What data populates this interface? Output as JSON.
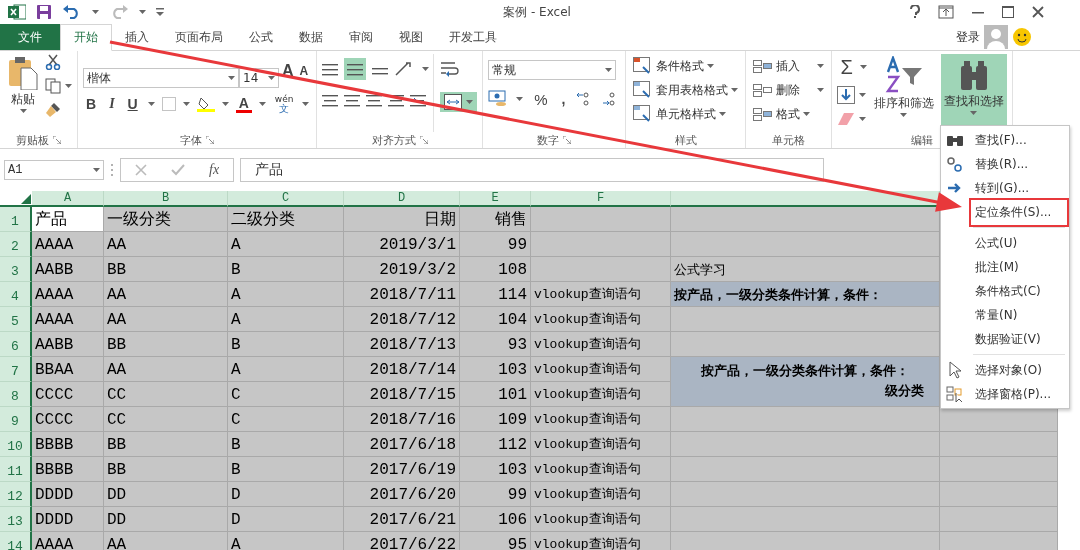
{
  "title_bar": {
    "title": "案例 - Excel"
  },
  "tabs": [
    {
      "label": "文件",
      "kind": "file",
      "selected": false
    },
    {
      "label": "开始",
      "kind": "tab",
      "selected": true
    },
    {
      "label": "插入",
      "kind": "tab",
      "selected": false
    },
    {
      "label": "页面布局",
      "kind": "tab",
      "selected": false
    },
    {
      "label": "公式",
      "kind": "tab",
      "selected": false
    },
    {
      "label": "数据",
      "kind": "tab",
      "selected": false
    },
    {
      "label": "审阅",
      "kind": "tab",
      "selected": false
    },
    {
      "label": "视图",
      "kind": "tab",
      "selected": false
    },
    {
      "label": "开发工具",
      "kind": "tab",
      "selected": false
    }
  ],
  "account": {
    "sign_in": "登录"
  },
  "ribbon": {
    "clipboard": {
      "label": "剪贴板",
      "paste": "粘贴"
    },
    "font": {
      "label": "字体",
      "name": "楷体",
      "size": "14",
      "grow": "A",
      "shrink": "A",
      "bold": "B",
      "italic": "I",
      "underline": "U",
      "font_color": "A",
      "phonetic_top": "wén",
      "phonetic_bottom": "文"
    },
    "alignment": {
      "label": "对齐方式"
    },
    "number": {
      "label": "数字",
      "format": "常规",
      "percent": "%",
      "comma": ","
    },
    "styles": {
      "label": "样式",
      "items": [
        "条件格式",
        "套用表格格式",
        "单元格样式"
      ]
    },
    "cells": {
      "label": "单元格",
      "items": [
        "插入",
        "删除",
        "格式"
      ]
    },
    "editing": {
      "label": "编辑",
      "sum": "Σ",
      "sort": "排序和筛选",
      "find": {
        "label": "查找和选择",
        "selected": true
      }
    }
  },
  "formula_bar": {
    "name_box": "A1",
    "function_symbol": "fx",
    "value": "产品"
  },
  "sheet": {
    "columns": [
      "A",
      "B",
      "C",
      "D",
      "E",
      "F"
    ],
    "rows": [
      {
        "number": "1",
        "active_first": true,
        "a": "产品",
        "b": "一级分类",
        "c": "二级分类",
        "d": "日期",
        "e": "销售"
      },
      {
        "number": "2",
        "active_first": false,
        "a": "AAAA",
        "b": "AA",
        "c": "A",
        "d": "2019/3/1",
        "e": "99"
      },
      {
        "number": "3",
        "active_first": false,
        "a": "AABB",
        "b": "BB",
        "c": "B",
        "d": "2019/3/2",
        "e": "108",
        "g": {
          "kind": "single",
          "text": "公式学习",
          "highlighted": false
        }
      },
      {
        "number": "4",
        "active_first": false,
        "a": "AAAA",
        "b": "AA",
        "c": "A",
        "d": "2018/7/11",
        "e": "114",
        "f": "vlookup查询语句",
        "g": {
          "kind": "single",
          "text": "按产品，一级分类条件计算，条件：",
          "highlighted": true
        }
      },
      {
        "number": "5",
        "active_first": false,
        "a": "AAAA",
        "b": "AA",
        "c": "A",
        "d": "2018/7/12",
        "e": "104",
        "f": "vlookup查询语句"
      },
      {
        "number": "6",
        "active_first": false,
        "a": "AABB",
        "b": "BB",
        "c": "B",
        "d": "2018/7/13",
        "e": "93",
        "f": "vlookup查询语句"
      },
      {
        "number": "7",
        "active_first": false,
        "a": "BBAA",
        "b": "AA",
        "c": "A",
        "d": "2018/7/14",
        "e": "103",
        "f": "vlookup查询语句",
        "g": {
          "kind": "merged",
          "text": "按产品，一级分类条件计算，条件：",
          "line2": "级分类",
          "highlighted": true
        }
      },
      {
        "number": "8",
        "active_first": false,
        "a": "CCCC",
        "b": "CC",
        "c": "C",
        "d": "2018/7/15",
        "e": "101",
        "f": "vlookup查询语句"
      },
      {
        "number": "9",
        "active_first": false,
        "a": "CCCC",
        "b": "CC",
        "c": "C",
        "d": "2018/7/16",
        "e": "109",
        "f": "vlookup查询语句"
      },
      {
        "number": "10",
        "active_first": false,
        "a": "BBBB",
        "b": "BB",
        "c": "B",
        "d": "2017/6/18",
        "e": "112",
        "f": "vlookup查询语句"
      },
      {
        "number": "11",
        "active_first": false,
        "a": "BBBB",
        "b": "BB",
        "c": "B",
        "d": "2017/6/19",
        "e": "103",
        "f": "vlookup查询语句"
      },
      {
        "number": "12",
        "active_first": false,
        "a": "DDDD",
        "b": "DD",
        "c": "D",
        "d": "2017/6/20",
        "e": "99",
        "f": "vlookup查询语句"
      },
      {
        "number": "13",
        "active_first": false,
        "a": "DDDD",
        "b": "DD",
        "c": "D",
        "d": "2017/6/21",
        "e": "106",
        "f": "vlookup查询语句"
      },
      {
        "number": "14",
        "active_first": false,
        "a": "AAAA",
        "b": "AA",
        "c": "A",
        "d": "2017/6/22",
        "e": "95",
        "f": "vlookup查询语句"
      }
    ]
  },
  "find_menu": {
    "items": [
      {
        "kind": "find",
        "label": "查找(F)...",
        "annotated": false
      },
      {
        "kind": "replace",
        "label": "替换(R)...",
        "annotated": false
      },
      {
        "kind": "goto",
        "label": "转到(G)...",
        "annotated": false
      },
      {
        "kind": "item",
        "label": "定位条件(S)...",
        "annotated": true
      },
      {
        "kind": "separator"
      },
      {
        "kind": "item",
        "label": "公式(U)",
        "annotated": false
      },
      {
        "kind": "item",
        "label": "批注(M)",
        "annotated": false
      },
      {
        "kind": "item",
        "label": "条件格式(C)",
        "annotated": false
      },
      {
        "kind": "item",
        "label": "常量(N)",
        "annotated": false
      },
      {
        "kind": "item",
        "label": "数据验证(V)",
        "annotated": false
      },
      {
        "kind": "separator"
      },
      {
        "kind": "objects",
        "label": "选择对象(O)",
        "annotated": false
      },
      {
        "kind": "pane",
        "label": "选择窗格(P)...",
        "annotated": false
      }
    ]
  }
}
